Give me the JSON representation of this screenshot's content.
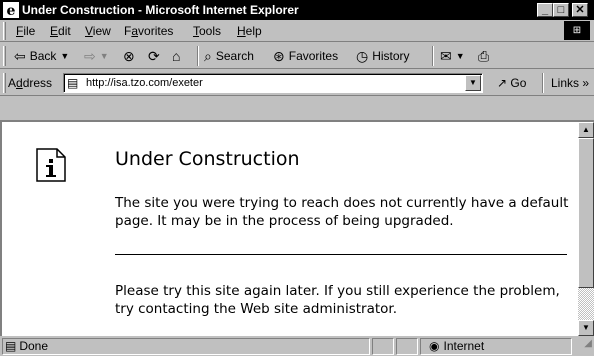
{
  "window": {
    "title": "Under Construction - Microsoft Internet Explorer",
    "minimize_glyph": "_",
    "maximize_glyph": "□",
    "close_glyph": "✕"
  },
  "menu": {
    "items": [
      {
        "label": "File",
        "accel": "F",
        "rest": "ile"
      },
      {
        "label": "Edit",
        "accel": "E",
        "rest": "dit"
      },
      {
        "label": "View",
        "accel": "V",
        "rest": "iew"
      },
      {
        "label": "Favorites",
        "prefix": "F",
        "accel": "a",
        "rest": "vorites"
      },
      {
        "label": "Tools",
        "accel": "T",
        "rest": "ools"
      },
      {
        "label": "Help",
        "accel": "H",
        "rest": "elp"
      }
    ]
  },
  "toolbar": {
    "back_label": "Back",
    "search_label": "Search",
    "favorites_label": "Favorites",
    "history_label": "History"
  },
  "address": {
    "label_accel": "d",
    "label": "Address",
    "url": "http://isa.tzo.com/exeter",
    "go_label": "Go",
    "links_label": "Links »"
  },
  "page": {
    "heading": "Under Construction",
    "message": "The site you were trying to reach does not currently have a default page. It may be in the process of being upgraded.",
    "advice": "Please try this site again later. If you still experience the problem, try contacting the Web site administrator."
  },
  "status": {
    "text": "Done",
    "zone": "Internet"
  }
}
